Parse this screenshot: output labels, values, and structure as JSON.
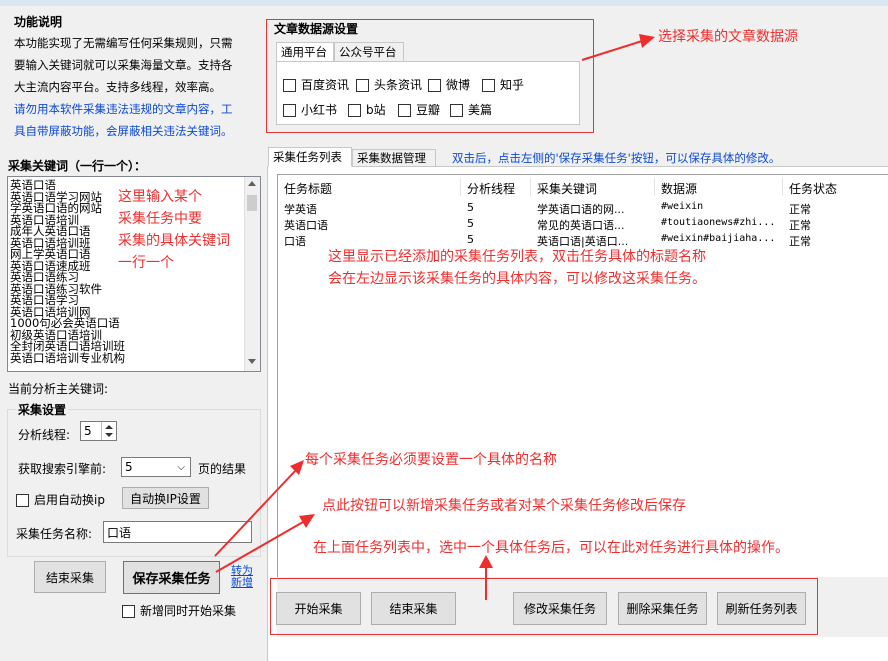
{
  "feature": {
    "title": "功能说明",
    "lines": [
      "本功能实现了无需编写任何采集规则，只需",
      "要输入关键词就可以采集海量文章。支持各",
      "大主流内容平台。支持多线程，效率高。"
    ],
    "warning_lines": [
      "请勿用本软件采集违法违规的文章内容，工",
      "具自带屏蔽功能，会屏蔽相关违法关键词。"
    ]
  },
  "source": {
    "title": "文章数据源设置",
    "tabs": [
      "通用平台",
      "公众号平台"
    ],
    "options_row1": [
      "百度资讯",
      "头条资讯",
      "微博",
      "知乎"
    ],
    "options_row2": [
      "小红书",
      "b站",
      "豆瓣",
      "美篇"
    ]
  },
  "keywords": {
    "title": "采集关键词（一行一个）：",
    "items": [
      "英语口语",
      "英语口语学习网站",
      "学英语口语的网站",
      "英语口语培训",
      "成年人英语口语",
      "英语口语培训班",
      "网上学英语口语",
      "英语口语速成班",
      "英语口语练习",
      "英语口语练习软件",
      "英语口语学习",
      "英语口语培训网",
      "1000句必会英语口语",
      "初级英语口语培训",
      "全封闭英语口语培训班",
      "英语口语培训专业机构"
    ]
  },
  "current_label": "当前分析主关键词:",
  "settings": {
    "title": "采集设置",
    "threads_label": "分析线程:",
    "threads_value": "5",
    "pages_label": "获取搜索引擎前:",
    "pages_value": "5",
    "pages_suffix": "页的结果",
    "auto_ip_label": "启用自动换ip",
    "auto_ip_button": "自动换IP设置",
    "task_name_label": "采集任务名称:",
    "task_name_value": "口语"
  },
  "left_buttons": {
    "stop": "结束采集",
    "save": "保存采集任务",
    "switch_new": "转为新增",
    "start_on_add": "新增同时开始采集"
  },
  "right_tabs": [
    "采集任务列表",
    "采集数据管理"
  ],
  "hint": "双击后，点击左侧的'保存采集任务'按钮，可以保存具体的修改。",
  "table": {
    "columns": [
      "任务标题",
      "分析线程",
      "采集关键词",
      "数据源",
      "任务状态"
    ],
    "rows": [
      [
        "学英语",
        "5",
        "学英语口语的网...",
        "#weixin",
        "正常"
      ],
      [
        "英语口语",
        "5",
        "常见的英语口语...",
        "#toutiaonews#zhi...",
        "正常"
      ],
      [
        "口语",
        "5",
        "英语口语|英语口...",
        "#weixin#baijiaha...",
        "正常"
      ]
    ]
  },
  "bottom_buttons": [
    "开始采集",
    "结束采集",
    "修改采集任务",
    "删除采集任务",
    "刷新任务列表"
  ],
  "annotations": {
    "source": "选择采集的文章数据源",
    "keywords": [
      "这里输入某个",
      "采集任务中要",
      "采集的具体关键词",
      "一行一个"
    ],
    "list": [
      "这里显示已经添加的采集任务列表，双击任务具体的标题名称",
      "会在左边显示该采集任务的具体内容，可以修改这采集任务。"
    ],
    "name": "每个采集任务必须要设置一个具体的名称",
    "save": "点此按钮可以新增采集任务或者对某个采集任务修改后保存",
    "ops": "在上面任务列表中，选中一个具体任务后，可以在此对任务进行具体的操作。"
  },
  "colors": {
    "annotation_red": "#f02d2d",
    "hint_blue": "#0c49d6"
  }
}
